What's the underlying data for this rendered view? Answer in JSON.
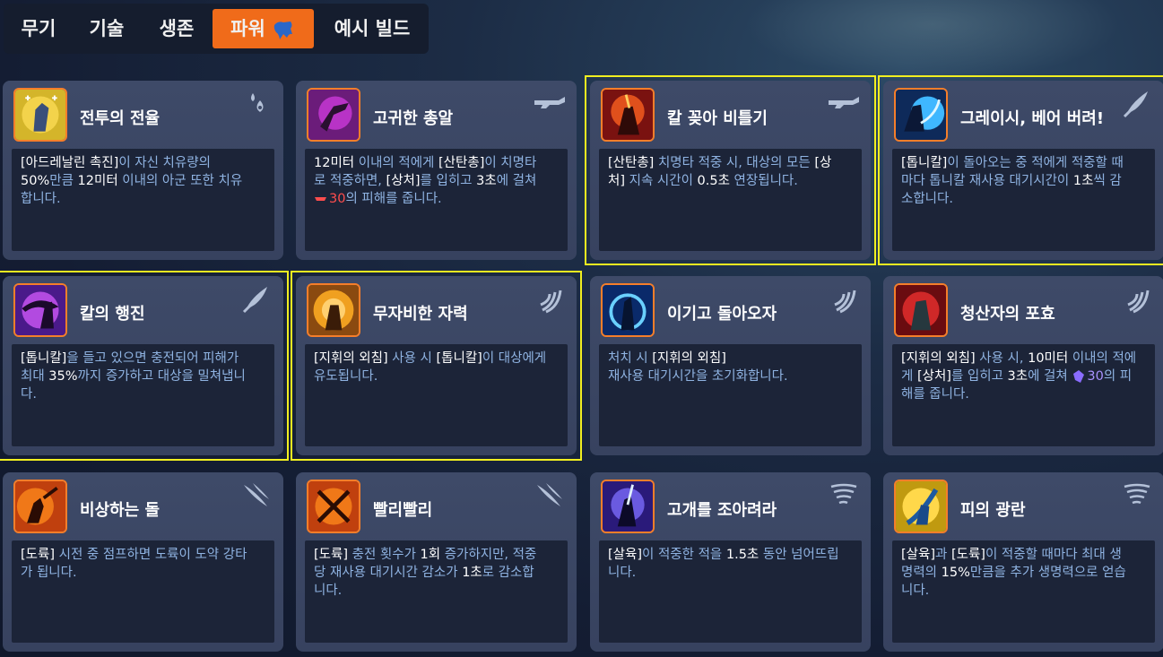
{
  "tabs": [
    {
      "label": "무기",
      "active": false
    },
    {
      "label": "기술",
      "active": false
    },
    {
      "label": "생존",
      "active": false
    },
    {
      "label": "파워",
      "active": true
    },
    {
      "label": "예시 빌드",
      "active": false
    }
  ],
  "colors": {
    "accent": "#f06b1a",
    "highlight": "#f1ef20",
    "keyword": "#8fb3e2"
  },
  "cards": [
    {
      "title": "전투의 전율",
      "category_icon": "drop-icon",
      "highlighted": false,
      "desc": [
        [
          {
            "t": "[아드레날린 촉진]"
          },
          {
            "t": "이 자신 치유량의 ",
            "c": "hl"
          }
        ],
        [
          {
            "t": "50%"
          },
          {
            "t": "만큼 ",
            "c": "hl"
          },
          {
            "t": "12미터"
          },
          {
            "t": " 이내의 아군 또한 치유",
            "c": "hl"
          }
        ],
        [
          {
            "t": "합니다.",
            "c": "hl"
          }
        ]
      ]
    },
    {
      "title": "고귀한 총알",
      "category_icon": "shotgun-icon",
      "highlighted": false,
      "desc": [
        [
          {
            "t": "12미터"
          },
          {
            "t": " 이내의 적에게 ",
            "c": "hl"
          },
          {
            "t": "[산탄총]"
          },
          {
            "t": "이 치명타",
            "c": "hl"
          }
        ],
        [
          {
            "t": "로 적중하면, ",
            "c": "hl"
          },
          {
            "t": "[상처]"
          },
          {
            "t": "를 입히고 ",
            "c": "hl"
          },
          {
            "t": "3초"
          },
          {
            "t": "에 걸쳐",
            "c": "hl"
          }
        ],
        [
          {
            "icon": "wound-icon"
          },
          {
            "t": "30",
            "c": "dmg"
          },
          {
            "t": "의 피해를 줍니다.",
            "c": "hl"
          }
        ]
      ]
    },
    {
      "title": "칼 꽂아 비틀기",
      "category_icon": "shotgun-icon",
      "highlighted": true,
      "desc": [
        [
          {
            "t": "[산탄총]"
          },
          {
            "t": " 치명타 적중 시, 대상의 모든 ",
            "c": "hl"
          },
          {
            "t": "[상"
          }
        ],
        [
          {
            "t": "처]"
          },
          {
            "t": " 지속 시간이 ",
            "c": "hl"
          },
          {
            "t": "0.5초"
          },
          {
            "t": " 연장됩니다.",
            "c": "hl"
          }
        ]
      ]
    },
    {
      "title": "그레이시, 베어 버려!",
      "category_icon": "blade-icon",
      "highlighted": true,
      "desc": [
        [
          {
            "t": "[톱니칼]"
          },
          {
            "t": "이 돌아오는 중 적에게 적중할 때",
            "c": "hl"
          }
        ],
        [
          {
            "t": "마다 톱니칼 재사용 대기시간이 ",
            "c": "hl"
          },
          {
            "t": "1초"
          },
          {
            "t": "씩 감",
            "c": "hl"
          }
        ],
        [
          {
            "t": "소합니다.",
            "c": "hl"
          }
        ]
      ]
    },
    {
      "title": "칼의 행진",
      "category_icon": "blade-icon",
      "highlighted": true,
      "desc": [
        [
          {
            "t": "[톱니칼]"
          },
          {
            "t": "을 들고 있으면 충전되어 피해가",
            "c": "hl"
          }
        ],
        [
          {
            "t": "최대 ",
            "c": "hl"
          },
          {
            "t": "35%"
          },
          {
            "t": "까지 증가하고 대상을 밀쳐냅니",
            "c": "hl"
          }
        ],
        [
          {
            "t": "다.",
            "c": "hl"
          }
        ]
      ]
    },
    {
      "title": "무자비한 자력",
      "category_icon": "shout-icon",
      "highlighted": true,
      "desc": [
        [
          {
            "t": "[지휘의 외침]"
          },
          {
            "t": " 사용 시 ",
            "c": "hl"
          },
          {
            "t": "[톱니칼]"
          },
          {
            "t": "이 대상에게",
            "c": "hl"
          }
        ],
        [
          {
            "t": "유도됩니다.",
            "c": "hl"
          }
        ]
      ]
    },
    {
      "title": "이기고 돌아오자",
      "category_icon": "shout-icon",
      "highlighted": false,
      "desc": [
        [
          {
            "t": "처치 시 ",
            "c": "hl"
          },
          {
            "t": "[지휘의 외침]"
          }
        ],
        [
          {
            "t": "재사용 대기시간을 초기화합니다.",
            "c": "hl"
          }
        ]
      ]
    },
    {
      "title": "청산자의 포효",
      "category_icon": "shout-icon",
      "highlighted": false,
      "desc": [
        [
          {
            "t": "[지휘의 외침]"
          },
          {
            "t": " 사용 시, ",
            "c": "hl"
          },
          {
            "t": "10미터"
          },
          {
            "t": " 이내의 적에",
            "c": "hl"
          }
        ],
        [
          {
            "t": "게 ",
            "c": "hl"
          },
          {
            "t": "[상처]"
          },
          {
            "t": "를 입히고 ",
            "c": "hl"
          },
          {
            "t": "3초"
          },
          {
            "t": "에 걸쳐 ",
            "c": "hl"
          },
          {
            "icon": "purple-wound-icon"
          },
          {
            "t": "30",
            "c": "dmgp"
          },
          {
            "t": "의 피",
            "c": "hl"
          }
        ],
        [
          {
            "t": "해를 줍니다.",
            "c": "hl"
          }
        ]
      ]
    },
    {
      "title": "비상하는 돌",
      "category_icon": "claw-icon",
      "highlighted": false,
      "desc": [
        [
          {
            "t": "[도륙]"
          },
          {
            "t": " 시전 중 점프하면 도륙이 도약 강타",
            "c": "hl"
          }
        ],
        [
          {
            "t": "가 됩니다.",
            "c": "hl"
          }
        ]
      ]
    },
    {
      "title": "빨리빨리",
      "category_icon": "claw-icon",
      "highlighted": false,
      "desc": [
        [
          {
            "t": "[도륙]"
          },
          {
            "t": " 충전 횟수가 ",
            "c": "hl"
          },
          {
            "t": "1회"
          },
          {
            "t": " 증가하지만, 적중",
            "c": "hl"
          }
        ],
        [
          {
            "t": "당 재사용 대기시간 감소가 ",
            "c": "hl"
          },
          {
            "t": "1초"
          },
          {
            "t": "로 감소합",
            "c": "hl"
          }
        ],
        [
          {
            "t": "니다.",
            "c": "hl"
          }
        ]
      ]
    },
    {
      "title": "고개를 조아려라",
      "category_icon": "tornado-icon",
      "highlighted": false,
      "desc": [
        [
          {
            "t": "[살육]"
          },
          {
            "t": "이 적중한 적을 ",
            "c": "hl"
          },
          {
            "t": "1.5초"
          },
          {
            "t": " 동안 넘어뜨립",
            "c": "hl"
          }
        ],
        [
          {
            "t": "니다.",
            "c": "hl"
          }
        ]
      ]
    },
    {
      "title": "피의 광란",
      "category_icon": "tornado-icon",
      "highlighted": false,
      "desc": [
        [
          {
            "t": "[살육]"
          },
          {
            "t": "과 ",
            "c": "hl"
          },
          {
            "t": "[도륙]"
          },
          {
            "t": "이 적중할 때마다 최대 생",
            "c": "hl"
          }
        ],
        [
          {
            "t": "명력의 ",
            "c": "hl"
          },
          {
            "t": "15%"
          },
          {
            "t": "만큼을 추가 생명력으로 얻습",
            "c": "hl"
          }
        ],
        [
          {
            "t": "니다.",
            "c": "hl"
          }
        ]
      ]
    }
  ]
}
